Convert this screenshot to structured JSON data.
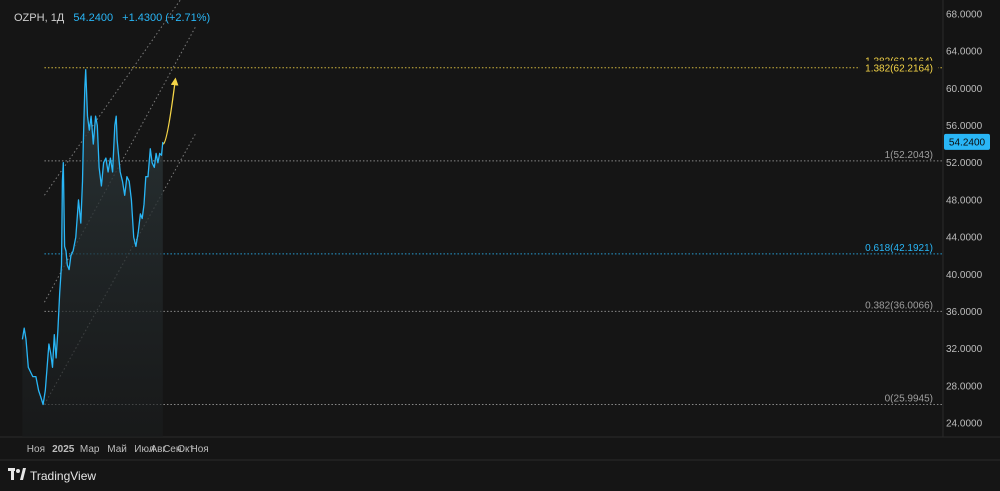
{
  "header": {
    "symbol": "OZPH",
    "interval": "1Д",
    "last_price": "54.2400",
    "change": "+1.4300 (+2.71%)"
  },
  "brand": {
    "icon": "tradingview-logo-icon",
    "name": "TradingView"
  },
  "colors": {
    "background": "#151515",
    "line": "#29b6f6",
    "highlight_level": "#f5d547",
    "fib_level": "#29b6f6",
    "neutral_level": "#9e9e9e",
    "axis_text": "#bdbdbd",
    "price_tag_bg": "#29b6f6"
  },
  "chart_data": {
    "type": "area",
    "x_ticks": [
      "Ноя",
      "2025",
      "Мар",
      "Май",
      "Июл",
      "Авг",
      "Сен",
      "Окт",
      "Ноя"
    ],
    "x_tick_dates": [
      "2024-11-01",
      "2025-01-01",
      "2025-03-01",
      "2025-05-01",
      "2025-07-01",
      "2025-08-01",
      "2025-09-01",
      "2025-10-01",
      "2025-11-01"
    ],
    "y_ticks": [
      "68.0000",
      "64.0000",
      "60.0000",
      "56.0000",
      "52.0000",
      "48.0000",
      "44.0000",
      "40.0000",
      "36.0000",
      "32.0000",
      "28.0000",
      "24.0000"
    ],
    "ylim": [
      22.5,
      69.5
    ],
    "last_price_tag": "54.2400",
    "series": [
      {
        "x": [
          "2024-10-02",
          "2024-10-06",
          "2024-10-10",
          "2024-10-15",
          "2024-10-20",
          "2024-10-25",
          "2024-11-01",
          "2024-11-07",
          "2024-11-12",
          "2024-11-17",
          "2024-11-22",
          "2024-11-26",
          "2024-11-30",
          "2024-12-04",
          "2024-12-08",
          "2024-12-12",
          "2024-12-16",
          "2024-12-20",
          "2024-12-24",
          "2024-12-28",
          "2024-12-30",
          "2025-01-01",
          "2025-01-04",
          "2025-01-07",
          "2025-01-10",
          "2025-01-14",
          "2025-01-18",
          "2025-01-23",
          "2025-01-29",
          "2025-02-04",
          "2025-02-09",
          "2025-02-13",
          "2025-02-15",
          "2025-02-18",
          "2025-02-20",
          "2025-02-24",
          "2025-02-28",
          "2025-03-04",
          "2025-03-09",
          "2025-03-14",
          "2025-03-18",
          "2025-03-22",
          "2025-03-27",
          "2025-04-01",
          "2025-04-06",
          "2025-04-11",
          "2025-04-16",
          "2025-04-21",
          "2025-04-26",
          "2025-04-29",
          "2025-05-01",
          "2025-05-04",
          "2025-05-08",
          "2025-05-13",
          "2025-05-18",
          "2025-05-23",
          "2025-05-28",
          "2025-06-02",
          "2025-06-07",
          "2025-06-12",
          "2025-06-17",
          "2025-06-22",
          "2025-06-26",
          "2025-06-30",
          "2025-07-04",
          "2025-07-09",
          "2025-07-14",
          "2025-07-18",
          "2025-07-23",
          "2025-07-27",
          "2025-07-31",
          "2025-08-04",
          "2025-08-08",
          "2025-08-11"
        ],
        "values": [
          33.0,
          34.2,
          33.0,
          30.0,
          29.5,
          29.0,
          29.0,
          27.5,
          26.8,
          26.0,
          27.5,
          30.0,
          32.5,
          31.5,
          30.0,
          33.5,
          31.0,
          34.0,
          38.0,
          41.0,
          50.0,
          52.0,
          43.0,
          42.5,
          41.0,
          40.5,
          42.0,
          42.5,
          44.0,
          48.0,
          45.5,
          50.0,
          54.5,
          60.0,
          62.0,
          57.0,
          55.5,
          57.0,
          54.0,
          57.0,
          56.0,
          51.5,
          49.5,
          52.0,
          52.5,
          51.0,
          52.5,
          51.0,
          56.0,
          57.0,
          54.5,
          53.0,
          51.0,
          50.0,
          48.5,
          50.5,
          50.0,
          48.0,
          44.0,
          43.0,
          44.5,
          46.5,
          46.0,
          47.5,
          50.5,
          50.5,
          53.5,
          52.0,
          51.5,
          53.0,
          52.0,
          53.0,
          52.8,
          54.24
        ]
      }
    ],
    "fib_levels": [
      {
        "ratio": "1.382",
        "value": 62.2164,
        "label": "1.382(62.2164)",
        "style": "highlight"
      },
      {
        "ratio": "1",
        "value": 52.2043,
        "label": "1(52.2043)",
        "style": "neutral"
      },
      {
        "ratio": "0.618",
        "value": 42.1921,
        "label": "0.618(42.1921)",
        "style": "fib"
      },
      {
        "ratio": "0.382",
        "value": 36.0066,
        "label": "0.382(36.0066)",
        "style": "neutral"
      },
      {
        "ratio": "0",
        "value": 25.9945,
        "label": "0(25.9945)",
        "style": "neutral"
      }
    ],
    "channel": {
      "start_date": "2024-11-20",
      "end_date": "2025-10-25",
      "lines": [
        {
          "name": "upper",
          "start_value": 48.5,
          "end_value": 72.0
        },
        {
          "name": "middle",
          "start_value": 37.0,
          "end_value": 66.8
        },
        {
          "name": "lower",
          "start_value": 26.0,
          "end_value": 55.3
        }
      ]
    },
    "projection_arrow": {
      "from_date": "2025-08-12",
      "from_value": 54.0,
      "to_date": "2025-09-08",
      "to_value": 61.0
    },
    "grid": false,
    "legend": "none"
  }
}
